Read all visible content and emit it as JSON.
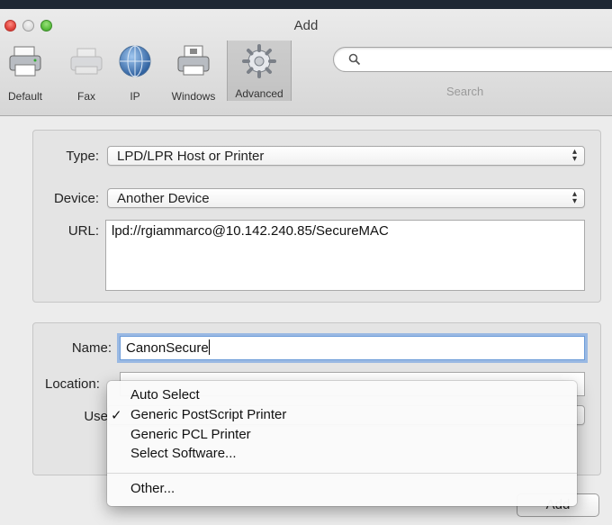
{
  "window": {
    "title": "Add"
  },
  "toolbar": {
    "items": [
      {
        "label": "Default",
        "icon": "printer-icon"
      },
      {
        "label": "Fax",
        "icon": "fax-icon"
      },
      {
        "label": "IP",
        "icon": "globe-icon"
      },
      {
        "label": "Windows",
        "icon": "windows-printer-icon"
      },
      {
        "label": "Advanced",
        "icon": "gear-icon",
        "selected": true
      }
    ],
    "search": {
      "label": "Search",
      "placeholder": ""
    }
  },
  "form": {
    "type": {
      "label": "Type:",
      "value": "LPD/LPR Host or Printer"
    },
    "device": {
      "label": "Device:",
      "value": "Another Device"
    },
    "url": {
      "label": "URL:",
      "value": "lpd://rgiammarco@10.142.240.85/SecureMAC"
    },
    "name": {
      "label": "Name:",
      "value": "CanonSecure"
    },
    "location": {
      "label": "Location:",
      "value": ""
    },
    "use": {
      "label": "Use"
    }
  },
  "use_menu": {
    "items": [
      {
        "label": "Auto Select",
        "checked": false
      },
      {
        "label": "Generic PostScript Printer",
        "checked": true
      },
      {
        "label": "Generic PCL Printer",
        "checked": false
      },
      {
        "label": "Select Software...",
        "checked": false
      }
    ],
    "other": "Other...",
    "check_glyph": "✓"
  },
  "buttons": {
    "add": "Add"
  },
  "colors": {
    "focus_ring": "#5c96e1",
    "close": "#e0443e",
    "zoom": "#5bbf3e"
  }
}
